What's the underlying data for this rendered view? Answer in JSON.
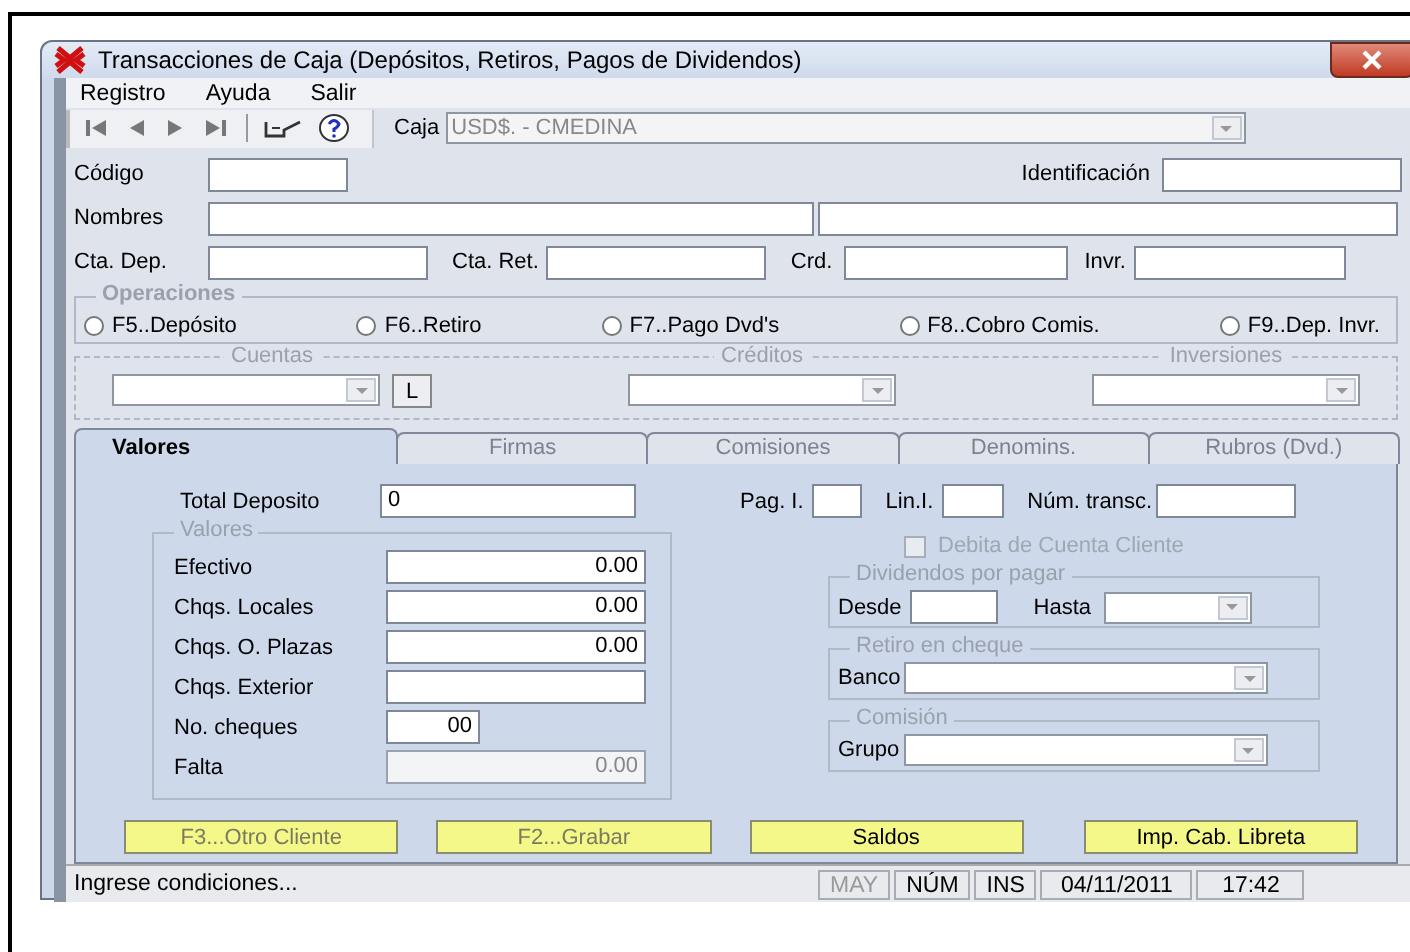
{
  "window": {
    "title": "Transacciones de Caja (Depósitos, Retiros, Pagos de Dividendos)"
  },
  "menu": [
    "Registro",
    "Ayuda",
    "Salir"
  ],
  "toolbar": {
    "caja_label": "Caja",
    "caja_value": "USD$. - CMEDINA"
  },
  "header": {
    "codigo": "Código",
    "identificacion": "Identificación",
    "nombres": "Nombres",
    "cta_dep": "Cta. Dep.",
    "cta_ret": "Cta. Ret.",
    "crd": "Crd.",
    "invr": "Invr."
  },
  "operaciones": {
    "title": "Operaciones",
    "options": [
      {
        "label": "F5..Depósito",
        "selected": false
      },
      {
        "label": "F6..Retiro",
        "selected": false
      },
      {
        "label": "F7..Pago Dvd's",
        "selected": false
      },
      {
        "label": "F8..Cobro Comis.",
        "selected": false
      },
      {
        "label": "F9..Dep. Invr.",
        "selected": false
      }
    ]
  },
  "selectors": {
    "groups": [
      "Cuentas",
      "Créditos",
      "Inversiones"
    ],
    "l_button": "L"
  },
  "tabs": [
    {
      "label": "Valores",
      "selected": true,
      "disabled": false
    },
    {
      "label": "Firmas",
      "selected": false,
      "disabled": true
    },
    {
      "label": "Comisiones",
      "selected": false,
      "disabled": true
    },
    {
      "label": "Denomins.",
      "selected": false,
      "disabled": true
    },
    {
      "label": "Rubros (Dvd.)",
      "selected": false,
      "disabled": true
    }
  ],
  "panel": {
    "total_label": "Total Deposito",
    "total_value": "0",
    "pag": "Pag. I.",
    "lin": "Lin.I.",
    "num": "Núm. transc.",
    "valores": {
      "title": "Valores",
      "rows": [
        {
          "label": "Efectivo",
          "value": "0.00",
          "kind": "wide",
          "disabled": false
        },
        {
          "label": "Chqs. Locales",
          "value": "0.00",
          "kind": "wide",
          "disabled": false
        },
        {
          "label": "Chqs. O. Plazas",
          "value": "0.00",
          "kind": "wide",
          "disabled": false
        },
        {
          "label": "Chqs. Exterior",
          "kind": "wide",
          "disabled": false
        },
        {
          "label": "No. cheques",
          "value": "00",
          "kind": "short",
          "disabled": false
        },
        {
          "label": "Falta",
          "value": "0.00",
          "kind": "wide",
          "disabled": true
        }
      ]
    },
    "debita": {
      "label": "Debita de Cuenta Cliente",
      "checked": false,
      "disabled": true
    },
    "dividendos": {
      "title": "Dividendos por pagar",
      "desde": "Desde",
      "hasta": "Hasta"
    },
    "retiro": {
      "title": "Retiro en cheque",
      "label": "Banco"
    },
    "comision": {
      "title": "Comisión",
      "label": "Grupo"
    }
  },
  "buttons": [
    {
      "label": "F3...Otro Cliente",
      "disabled": true
    },
    {
      "label": "F2...Grabar",
      "disabled": true
    },
    {
      "label": "Saldos",
      "disabled": false
    },
    {
      "label": "Imp. Cab. Libreta",
      "disabled": false
    }
  ],
  "status_bar": {
    "message": "Ingrese condiciones...",
    "indicators": [
      {
        "label": "MAY",
        "disabled": true
      },
      {
        "label": "NÚM",
        "disabled": false
      },
      {
        "label": "INS",
        "disabled": false
      }
    ],
    "date": "04/11/2011",
    "time": "17:42"
  }
}
